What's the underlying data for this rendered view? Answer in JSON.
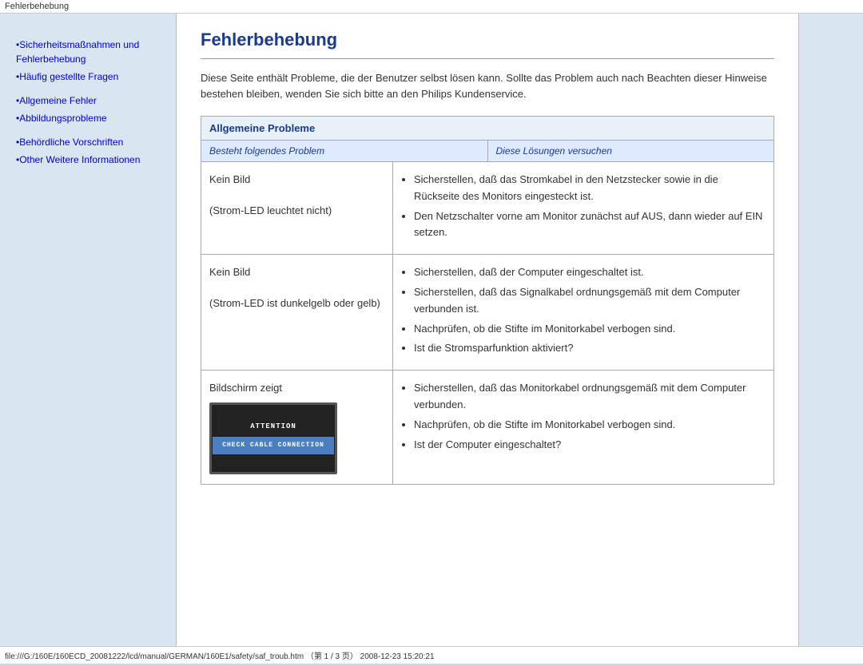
{
  "titleBar": {
    "text": "Fehlerbehebung"
  },
  "sidebar": {
    "links": [
      {
        "label": "•Sicherheitsmaßnahmen und Fehlerbehebung",
        "multiline": true
      },
      {
        "label": "•Häufig gestellte Fragen"
      },
      {
        "label": "•Allgemeine Fehler"
      },
      {
        "label": "•Abbildungsprobleme"
      },
      {
        "label": "•Behördliche Vorschriften"
      },
      {
        "label": "•Other Weitere Informationen"
      }
    ]
  },
  "content": {
    "title": "Fehlerbehebung",
    "intro": "Diese Seite enthält Probleme, die der Benutzer selbst lösen kann. Sollte das Problem auch nach Beachten dieser Hinweise bestehen bleiben, wenden Sie sich bitte an den Philips Kundenservice.",
    "tableHeader": "Allgemeine Probleme",
    "colProblem": "Besteht folgendes Problem",
    "colSolution": "Diese Lösungen versuchen",
    "rows": [
      {
        "problem": "Kein Bild\n\n(Strom-LED leuchtet nicht)",
        "solutions": [
          "Sicherstellen, daß das Stromkabel in den Netzstecker sowie in die Rückseite des Monitors eingesteckt ist.",
          "Den Netzschalter vorne am Monitor zunächst auf AUS, dann wieder auf EIN setzen."
        ]
      },
      {
        "problem": "Kein Bild\n\n(Strom-LED ist dunkelgelb oder gelb)",
        "solutions": [
          "Sicherstellen, daß der Computer eingeschaltet ist.",
          "Sicherstellen, daß das Signalkabel ordnungsgemäß mit dem Computer verbunden ist.",
          "Nachprüfen, ob die Stifte im Monitorkabel verbogen sind.",
          "Ist die Stromsparfunktion aktiviert?"
        ]
      },
      {
        "problem": "Bildschirm zeigt",
        "hasMonitor": true,
        "solutions": [
          "Sicherstellen, daß das Monitorkabel ordnungsgemäß mit dem Computer verbunden.",
          "Nachprüfen, ob die Stifte im Monitorkabel verbogen sind.",
          "Ist der Computer eingeschaltet?"
        ]
      }
    ]
  },
  "monitor": {
    "attention": "ATTENTION",
    "check": "CHECK CABLE CONNECTION"
  },
  "statusBar": {
    "text": "file:///G:/160E/160ECD_20081222/lcd/manual/GERMAN/160E1/safety/saf_troub.htm （第 1 / 3 页） 2008-12-23 15:20:21"
  }
}
